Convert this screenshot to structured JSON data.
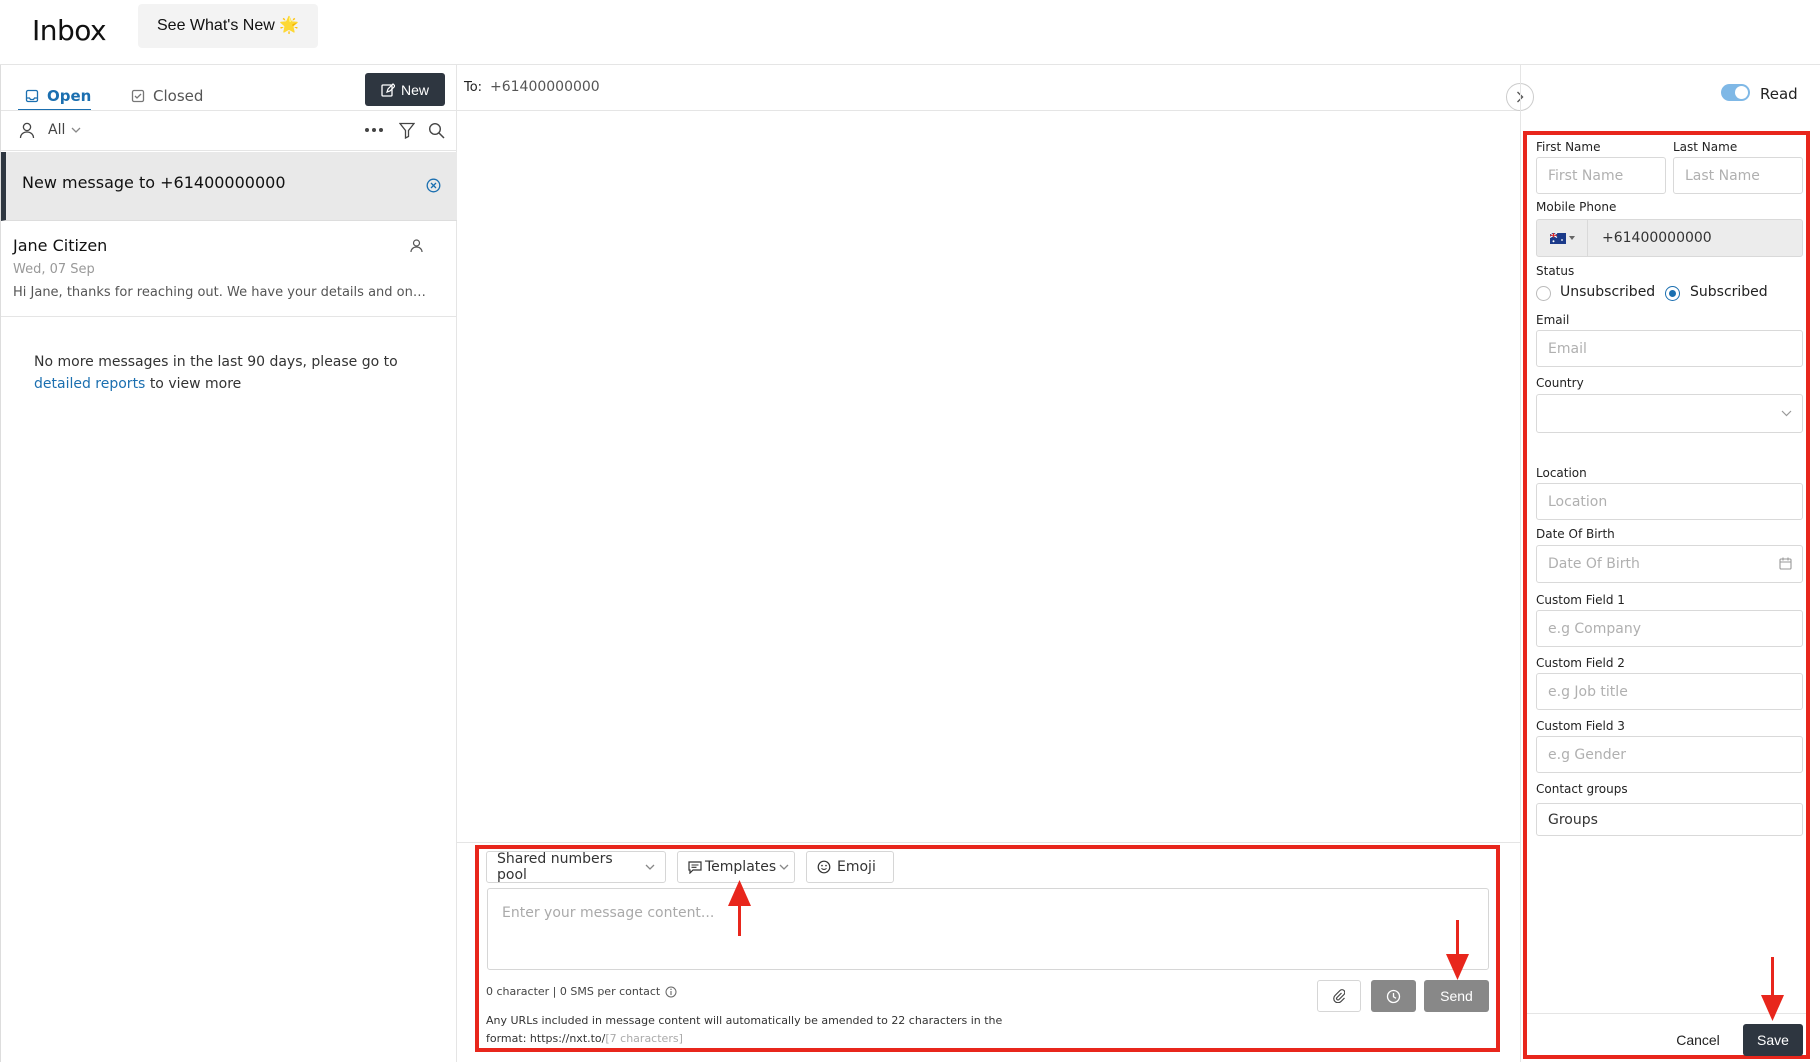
{
  "header": {
    "title": "Inbox",
    "whats_new_label": "See What's New",
    "whats_new_emoji": "🌟"
  },
  "left": {
    "tabs": [
      {
        "label": "Open"
      },
      {
        "label": "Closed"
      }
    ],
    "new_label": "New",
    "filter_label": "All",
    "conversations": [
      {
        "title": "New message to +61400000000"
      },
      {
        "name": "Jane Citizen",
        "date": "Wed, 07 Sep",
        "preview": "Hi Jane, thanks for reaching out. We have your details and one of our team will be in touch shortly."
      }
    ],
    "no_more_text": "No more messages in the last 90 days, please go to",
    "no_more_link": "detailed reports",
    "no_more_suffix": "to view more"
  },
  "middle": {
    "to_label": "To:",
    "to_value": "+61400000000",
    "composer": {
      "pool_label": "Shared numbers pool",
      "templates_label": "Templates",
      "emoji_label": "Emoji",
      "placeholder": "Enter your message content...",
      "char_count": "0 character | 0 SMS per contact",
      "url_note": "Any URLs included in message content will automatically be amended to 22 characters in the format: https://nxt.to/",
      "url_note_muted": "[7 characters]",
      "send_label": "Send"
    }
  },
  "right": {
    "read_label": "Read",
    "read_on": true,
    "first_name_label": "First Name",
    "first_name_placeholder": "First Name",
    "last_name_label": "Last Name",
    "last_name_placeholder": "Last Name",
    "mobile_label": "Mobile Phone",
    "mobile_value": "+61400000000",
    "status_label": "Status",
    "status_options": [
      "Unsubscribed",
      "Subscribed"
    ],
    "status_selected": "Subscribed",
    "email_label": "Email",
    "email_placeholder": "Email",
    "country_label": "Country",
    "location_label": "Location",
    "location_placeholder": "Location",
    "dob_label": "Date Of Birth",
    "dob_placeholder": "Date Of Birth",
    "custom1_label": "Custom Field 1",
    "custom1_placeholder": "e.g Company",
    "custom2_label": "Custom Field 2",
    "custom2_placeholder": "e.g Job title",
    "custom3_label": "Custom Field 3",
    "custom3_placeholder": "e.g Gender",
    "groups_label": "Contact groups",
    "groups_value": "Groups",
    "cancel_label": "Cancel",
    "save_label": "Save"
  },
  "colors": {
    "accent": "#1b6fb0",
    "dark": "#2e3640",
    "highlight": "#e8261c"
  }
}
